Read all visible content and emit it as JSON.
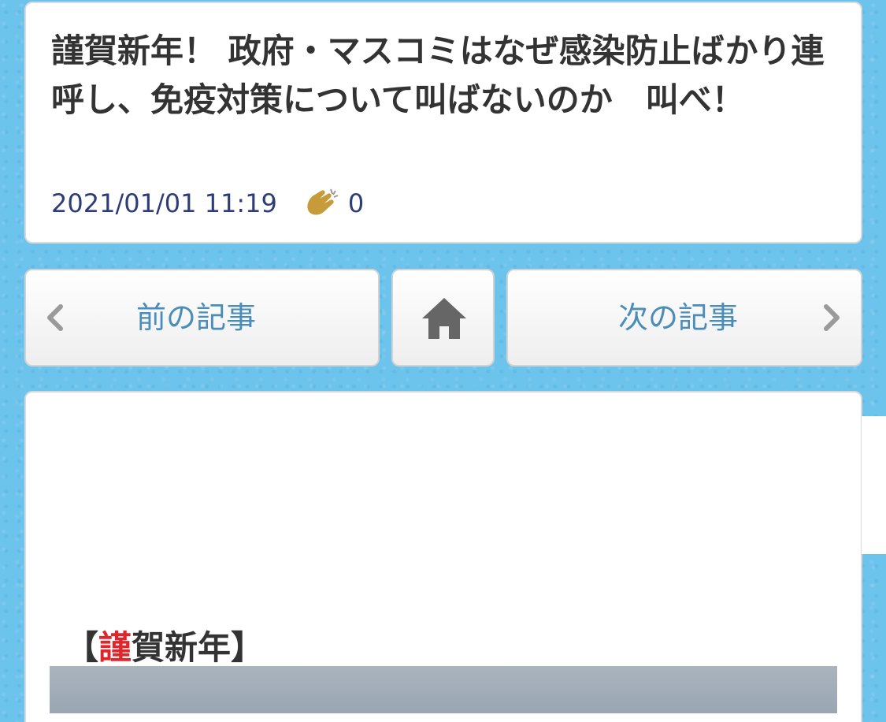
{
  "post": {
    "title": "謹賀新年！ 政府・マスコミはなぜ感染防止ばかり連呼し、免疫対策について叫ばないのか　叫べ！",
    "datetime": "2021/01/01 11:19",
    "clap_count": "0"
  },
  "nav": {
    "prev_label": "前の記事",
    "next_label": "次の記事"
  },
  "content": {
    "heading_open": "【",
    "heading_red": "謹",
    "heading_rest": "賀新年",
    "heading_close": "】"
  },
  "colors": {
    "background": "#6cc3ec",
    "title_text": "#333333",
    "meta_text": "#2e3c77",
    "nav_text": "#4a8db8",
    "accent_red": "#e0262b",
    "clap_icon": "#c79a3a"
  }
}
